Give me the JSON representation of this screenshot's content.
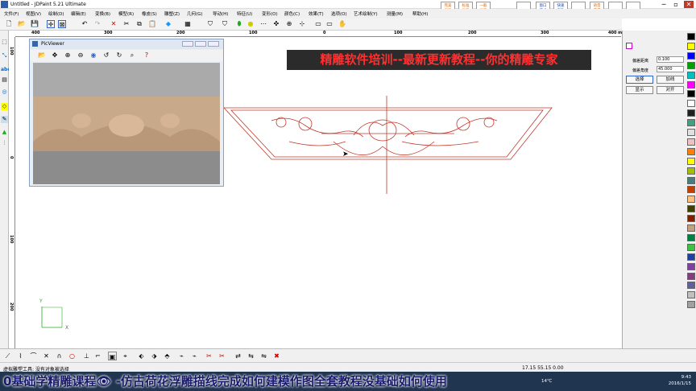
{
  "window": {
    "title": "Untitled - JDPaint 5.21 Ultimate",
    "minimize": "─",
    "restore": "▫",
    "close": "✕"
  },
  "menu": [
    "文件(F)",
    "视图(V)",
    "绘制(D)",
    "编辑(E)",
    "变换(B)",
    "模型(R)",
    "橡皮(S)",
    "雕塑(Z)",
    "几何(G)",
    "导动(H)",
    "特征(U)",
    "变形(O)",
    "颜色(C)",
    "效果(T)",
    "选项(O)",
    "艺术绘制(Y)",
    "测量(M)",
    "帮助(H)"
  ],
  "big_buttons": [
    {
      "label": "完美\n画质",
      "style": "orange"
    },
    {
      "label": "标准\n画质",
      "style": "orange"
    },
    {
      "label": "一般\n画质",
      "style": "orange"
    },
    {
      "label": "",
      "style": "blue"
    },
    {
      "label": "窗口\n模式",
      "style": "blue"
    },
    {
      "label": "快速\n高效",
      "style": "blue"
    },
    {
      "label": "",
      "style": "blue"
    },
    {
      "label": "语音\n广播",
      "style": "orange"
    },
    {
      "label": "",
      "style": "blue"
    },
    {
      "label": "",
      "style": "blue"
    }
  ],
  "ruler_top": [
    "400",
    "300",
    "200",
    "100",
    "0",
    "100",
    "200",
    "300",
    "400",
    "mm"
  ],
  "ruler_left": [
    "100",
    "0",
    "100",
    "200"
  ],
  "banner": "精雕软件培训--最新更新教程--你的精雕专家",
  "picviewer": {
    "title": "PicViewer"
  },
  "right_panel": {
    "row1_label": "偏差距离",
    "row1_value": "0.100",
    "row2_label": "偏差角度",
    "row2_value": "45.000",
    "btn_select": "选择",
    "btn_add": "加线",
    "btn_show": "显示",
    "btn_apply": "对开"
  },
  "palette": [
    "#000000",
    "#ffff00",
    "#0000ff",
    "#00a000",
    "#00c0c0",
    "#ff00ff",
    "#000000",
    "#ffffff",
    "#202020",
    "#40a080",
    "#e0e0e0",
    "#f0c0c0",
    "#ff8000",
    "#ffff00",
    "#a0c000",
    "#408080",
    "#c04000",
    "#ffc080",
    "#404000",
    "#802000",
    "#c0a080",
    "#008040",
    "#40c040",
    "#2040a0",
    "#8040a0",
    "#804080",
    "#6060a0",
    "#c0c0c0",
    "#a0a0a0"
  ],
  "axes": {
    "y": "Y",
    "x": "X"
  },
  "status": {
    "message": "虚拟雕塑工具: 没有对象被选择",
    "coords": "17.15 55.15 0.00"
  },
  "caption": "0基础学精雕课程👁 -仿古荷花浮雕描线完成如何建模作图全套教程没基础如何使用",
  "clock": {
    "temp": "14℃",
    "time": "9:43",
    "date": "2016/1/15"
  }
}
